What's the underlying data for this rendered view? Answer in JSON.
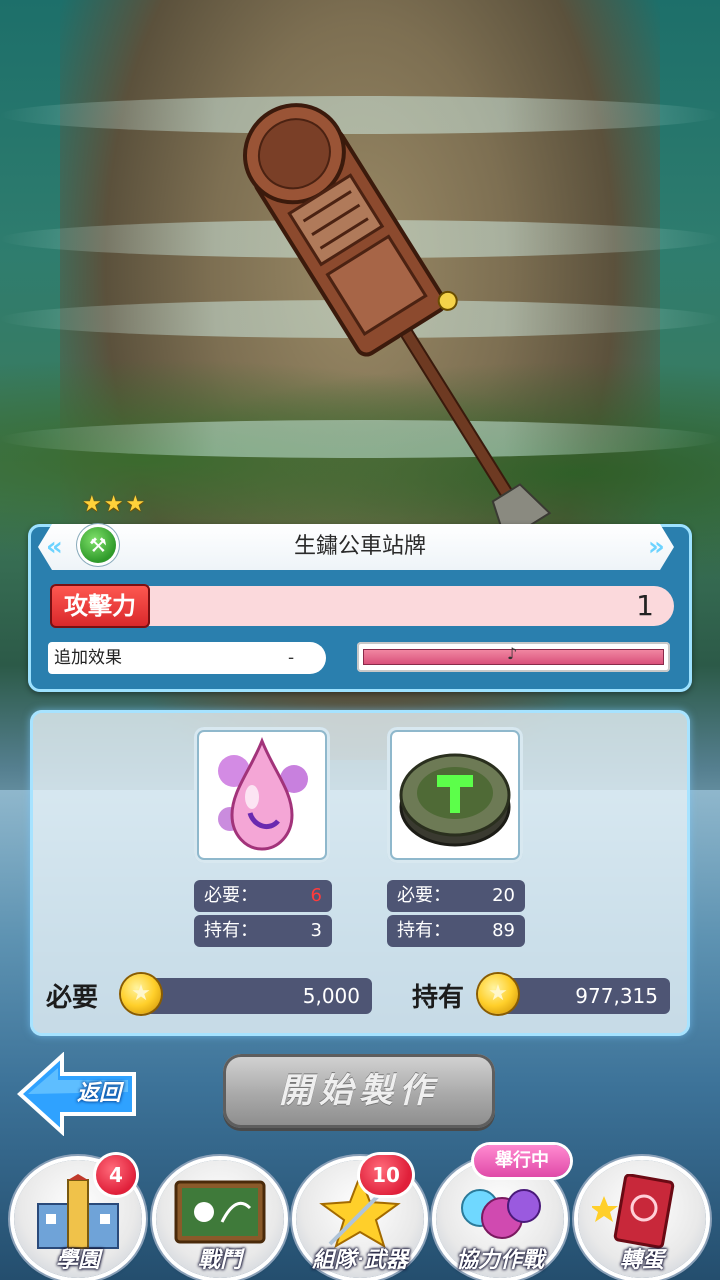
{
  "weapon": {
    "stars": 3,
    "name": "生鏽公車站牌",
    "type_icon": "hammer-icon"
  },
  "stats": {
    "attack_label": "攻擊力",
    "attack_value": "1",
    "extra_effect_label": "追加效果",
    "extra_effect_value": "-",
    "effect_gauge_level": 1.0
  },
  "materials": [
    {
      "icon": "purple-drop-icon",
      "required_label": "必要：",
      "required_value": "6",
      "owned_label": "持有：",
      "owned_value": "3",
      "insufficient": true
    },
    {
      "icon": "green-hammer-stone-icon",
      "required_label": "必要：",
      "required_value": "20",
      "owned_label": "持有：",
      "owned_value": "89",
      "insufficient": false
    }
  ],
  "gold": {
    "required_label": "必要",
    "required_value": "5,000",
    "owned_label": "持有",
    "owned_value": "977,315"
  },
  "actions": {
    "back_label": "返回",
    "start_label": "開始製作"
  },
  "nav": [
    {
      "label": "學園",
      "icon": "school-building-icon",
      "badge": "4"
    },
    {
      "label": "戰鬥",
      "icon": "battle-board-icon",
      "badge": ""
    },
    {
      "label": "組隊‧武器",
      "icon": "star-weapon-icon",
      "badge": "10"
    },
    {
      "label": "協力作戰",
      "icon": "co-op-balloon-icon",
      "badge": "",
      "tag": "舉行中"
    },
    {
      "label": "轉蛋",
      "icon": "gacha-card-icon",
      "badge": ""
    }
  ],
  "colors": {
    "attack_red": "#d8262a",
    "panel_blue": "#2a7fae",
    "stat_dark": "#4e5574",
    "insufficient_red": "#ff3b3b",
    "gauge_pink": "#d84d78"
  }
}
